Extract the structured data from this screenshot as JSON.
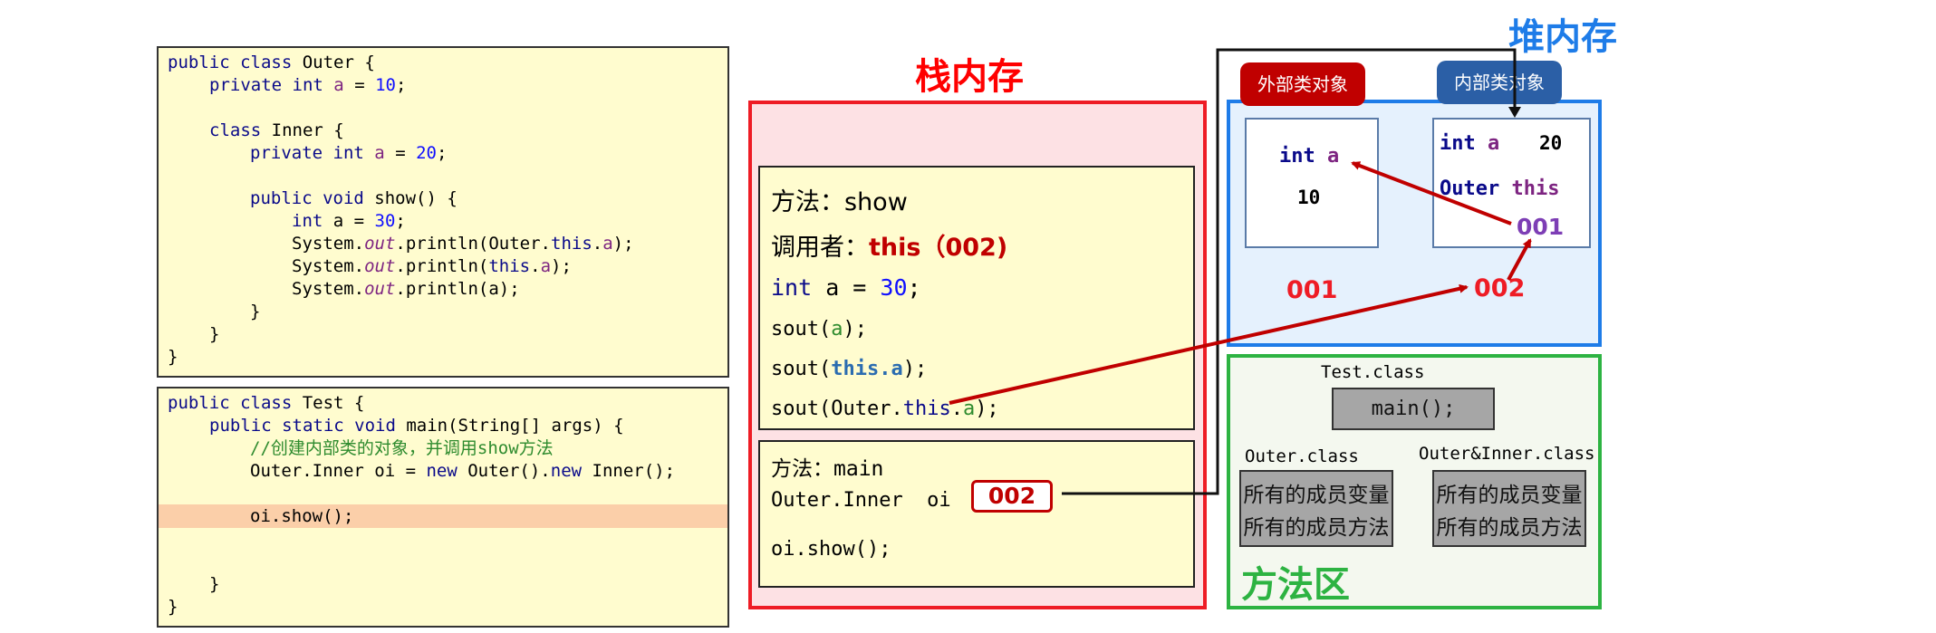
{
  "code_outer": {
    "l1": [
      "public class",
      " Outer {"
    ],
    "l2": [
      "private int",
      " ",
      "a",
      " = ",
      "10",
      ";"
    ],
    "l4": [
      "class",
      " Inner {"
    ],
    "l5": [
      "private int",
      " ",
      "a",
      " = ",
      "20",
      ";"
    ],
    "l7": [
      "public void",
      " show() {"
    ],
    "l8": [
      "int",
      " a = ",
      "30",
      ";"
    ],
    "l9": [
      "System.",
      "out",
      ".println(Outer.",
      "this",
      ".",
      "a",
      ");"
    ],
    "l10": [
      "System.",
      "out",
      ".println(",
      "this",
      ".",
      "a",
      ");"
    ],
    "l11": [
      "System.",
      "out",
      ".println(a);"
    ],
    "l12": "}",
    "l13": "}",
    "l14": "}"
  },
  "code_test": {
    "l1": [
      "public class",
      " Test {"
    ],
    "l2": [
      "public static void",
      " main(String[] args) {"
    ],
    "l3": "//创建内部类的对象，并调用show方法",
    "l4": [
      "Outer.Inner oi = ",
      "new",
      " Outer().",
      "new",
      " Inner();"
    ],
    "l5": "oi.show();",
    "l6": "}",
    "l7": "}"
  },
  "stack": {
    "title": "栈内存",
    "show_frame": {
      "method": "方法：show",
      "caller_label": "调用者：",
      "caller_value": "this（002)",
      "local": [
        "int",
        " a = ",
        "30",
        ";"
      ],
      "sout1": [
        "sout(",
        "a",
        ");"
      ],
      "sout2": [
        "sout(",
        "this.a",
        ");"
      ],
      "sout3": [
        "sout(Outer.",
        "this",
        ".",
        "a",
        ");"
      ]
    },
    "main_frame": {
      "method": "方法：main",
      "var": "Outer.Inner  oi",
      "ref": "002",
      "call": "oi.show();"
    }
  },
  "heap": {
    "title": "堆内存",
    "outer_tag": "外部类对象",
    "inner_tag": "内部类对象",
    "outer_obj": {
      "field_type": "int",
      "field_name": "a",
      "value": "10",
      "address": "001"
    },
    "inner_obj": {
      "field_type": "int",
      "field_name": "a",
      "value": "20",
      "ref_type": "Outer",
      "ref_name": "this",
      "ref_value": "001",
      "address": "002"
    }
  },
  "method_area": {
    "title": "方法区",
    "test_class": "Test.class",
    "test_method": "main();",
    "outer_class": "Outer.class",
    "inner_class": "Outer&Inner.class",
    "members_vars": "所有的成员变量",
    "members_methods": "所有的成员方法"
  },
  "colors": {
    "stack_border": "#ee1c25",
    "heap_border": "#1e7ce8",
    "method_border": "#2db342",
    "arrow": "#c00000"
  }
}
